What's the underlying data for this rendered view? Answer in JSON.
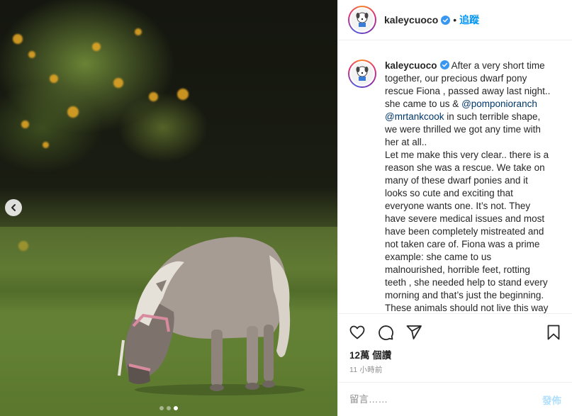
{
  "post": {
    "username": "kaleycuoco",
    "separator": "•",
    "follow_label": "追蹤",
    "caption_lines": [
      "After a very short time",
      "together, our precious dwarf pony",
      "rescue Fiona , passed away last night..",
      "she came to us & ",
      " in such terrible shape,",
      "we were thrilled we got any time with",
      "her at all..",
      "Let me make this very clear.. there is a",
      "reason she was a rescue. We take on",
      "many of these dwarf ponies and it",
      "looks so cute and exciting that",
      "everyone wants one. It’s not. They",
      "have severe medical issues and most",
      "have been completely mistreated and",
      "not taken care of. Fiona was a prime",
      "example: she came to us",
      "malnourished, horrible feet, rotting",
      "teeth , she needed help to stand every",
      "morning and that’s just the beginning.",
      "These animals should not live this way"
    ],
    "mentions": [
      "@pomponioranch",
      "@mrtankcook"
    ],
    "likes": "12萬 個讚",
    "timestamp": "11 小時前",
    "comment_placeholder": "留言……",
    "post_button": "發佈"
  },
  "media": {
    "carousel_total": 3,
    "carousel_active_index": 2
  },
  "icons": {
    "like": "heart-icon",
    "comment": "comment-icon",
    "share": "share-icon",
    "save": "bookmark-icon",
    "prev": "chevron-left-icon",
    "verified": "verified-badge-icon"
  },
  "colors": {
    "link": "#0095f6",
    "verified": "#3897f0",
    "mention": "#00376b",
    "post_disabled": "#b2dffc"
  }
}
